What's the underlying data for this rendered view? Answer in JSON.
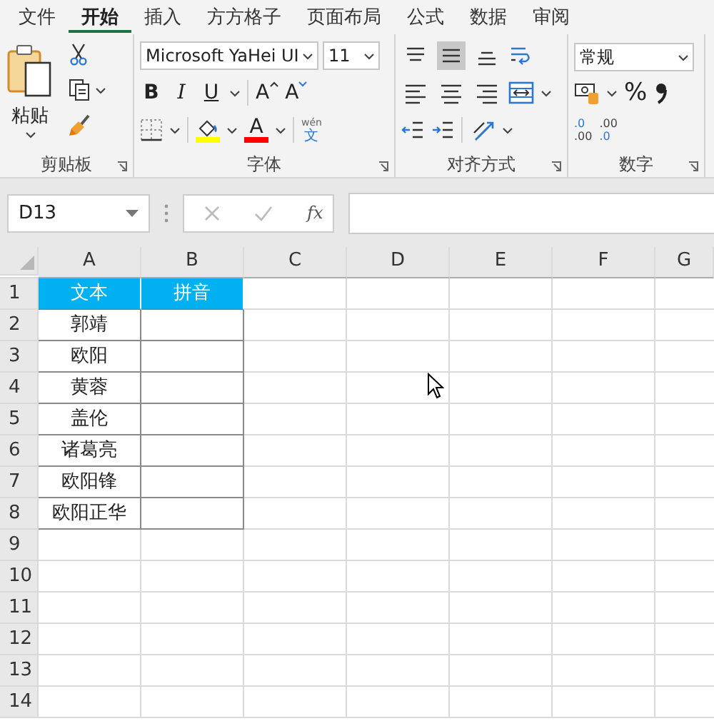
{
  "tabs": [
    {
      "label": "文件",
      "selected": false
    },
    {
      "label": "开始",
      "selected": true
    },
    {
      "label": "插入",
      "selected": false
    },
    {
      "label": "方方格子",
      "selected": false
    },
    {
      "label": "页面布局",
      "selected": false
    },
    {
      "label": "公式",
      "selected": false
    },
    {
      "label": "数据",
      "selected": false
    },
    {
      "label": "审阅",
      "selected": false
    }
  ],
  "ribbon": {
    "clipboard": {
      "paste_label": "粘贴",
      "title": "剪贴板"
    },
    "font": {
      "font_name": "Microsoft YaHei UI",
      "font_size": "11",
      "styles": [
        {
          "kind": "bold",
          "label": "B"
        },
        {
          "kind": "italic",
          "label": "I"
        },
        {
          "kind": "underline",
          "label": "U"
        }
      ],
      "grow_label": "A",
      "shrink_label": "A",
      "color_label": "A",
      "phonetic_top": "wén",
      "phonetic_bottom": "文",
      "title": "字体"
    },
    "alignment": {
      "buttons": [
        {
          "kind": "top",
          "selected": false
        },
        {
          "kind": "middle",
          "selected": true
        },
        {
          "kind": "bottom",
          "selected": false
        },
        {
          "kind": "left",
          "selected": false
        },
        {
          "kind": "center",
          "selected": false
        },
        {
          "kind": "right",
          "selected": false
        }
      ],
      "title": "对齐方式"
    },
    "number": {
      "format": "常规",
      "percent": "%",
      "decimals": [
        {
          "kind": "increase",
          "top": ".0",
          "bottom": ".00"
        },
        {
          "kind": "decrease",
          "top": ".00",
          "bottom": ".0"
        }
      ],
      "title": "数字"
    }
  },
  "formula_bar": {
    "name_box": "D13",
    "function_label": "fx"
  },
  "sheet": {
    "columns": [
      "A",
      "B",
      "C",
      "D",
      "E",
      "F",
      "G"
    ],
    "rows": [
      {
        "number": "1",
        "cells": [
          {
            "text": "文本",
            "kind": "header"
          },
          {
            "text": "拼音",
            "kind": "header"
          }
        ]
      },
      {
        "number": "2",
        "cells": [
          {
            "text": "郭靖",
            "kind": "data"
          },
          {
            "kind": "data"
          }
        ]
      },
      {
        "number": "3",
        "cells": [
          {
            "text": "欧阳",
            "kind": "data"
          },
          {
            "kind": "data"
          }
        ]
      },
      {
        "number": "4",
        "cells": [
          {
            "text": "黄蓉",
            "kind": "data"
          },
          {
            "kind": "data"
          }
        ]
      },
      {
        "number": "5",
        "cells": [
          {
            "text": "盖伦",
            "kind": "data"
          },
          {
            "kind": "data"
          }
        ]
      },
      {
        "number": "6",
        "cells": [
          {
            "text": "诸葛亮",
            "kind": "data"
          },
          {
            "kind": "data"
          }
        ]
      },
      {
        "number": "7",
        "cells": [
          {
            "text": "欧阳锋",
            "kind": "data"
          },
          {
            "kind": "data"
          }
        ]
      },
      {
        "number": "8",
        "cells": [
          {
            "text": "欧阳正华",
            "kind": "data"
          },
          {
            "kind": "data"
          }
        ]
      },
      {
        "number": "9",
        "cells": []
      },
      {
        "number": "10",
        "cells": []
      },
      {
        "number": "11",
        "cells": []
      },
      {
        "number": "12",
        "cells": []
      },
      {
        "number": "13",
        "cells": []
      },
      {
        "number": "14",
        "cells": []
      }
    ]
  }
}
